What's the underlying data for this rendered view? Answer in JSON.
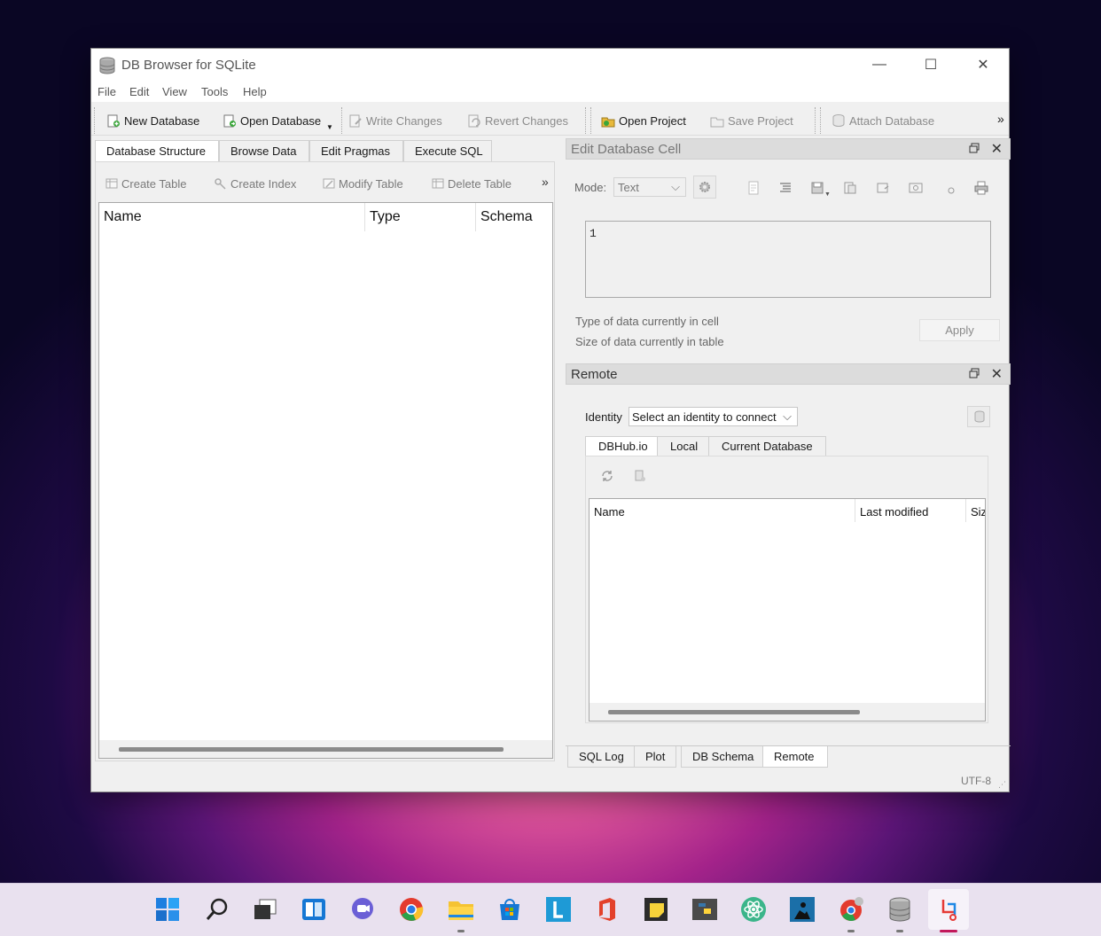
{
  "window": {
    "title": "DB Browser for SQLite",
    "controls": {
      "minimize": "—",
      "maximize": "☐",
      "close": "✕"
    }
  },
  "menu": [
    "File",
    "Edit",
    "View",
    "Tools",
    "Help"
  ],
  "toolbar": {
    "new_database": "New Database",
    "open_database": "Open Database",
    "write_changes": "Write Changes",
    "revert_changes": "Revert Changes",
    "open_project": "Open Project",
    "save_project": "Save Project",
    "attach_database": "Attach Database",
    "overflow": "»"
  },
  "main_tabs": [
    "Database Structure",
    "Browse Data",
    "Edit Pragmas",
    "Execute SQL"
  ],
  "structure_toolbar": {
    "create_table": "Create Table",
    "create_index": "Create Index",
    "modify_table": "Modify Table",
    "delete_table": "Delete Table",
    "overflow": "»"
  },
  "schema_tree": {
    "columns": [
      "Name",
      "Type",
      "Schema"
    ]
  },
  "edit_cell": {
    "title": "Edit Database Cell",
    "mode_label": "Mode:",
    "mode_value": "Text",
    "cell_value": "1",
    "type_info": "Type of data currently in cell",
    "size_info": "Size of data currently in table",
    "apply": "Apply"
  },
  "remote": {
    "title": "Remote",
    "identity_label": "Identity",
    "identity_value": "Select an identity to connect",
    "tabs": [
      "DBHub.io",
      "Local",
      "Current Database"
    ],
    "columns": [
      "Name",
      "Last modified",
      "Siz"
    ]
  },
  "bottom_tabs": [
    "SQL Log",
    "Plot",
    "DB Schema",
    "Remote"
  ],
  "status": {
    "encoding": "UTF-8"
  },
  "dock_controls": {
    "close": "✕"
  },
  "taskbar_icons": [
    "start-icon",
    "search-icon",
    "task-view-icon",
    "widgets-icon",
    "chat-icon",
    "chrome-icon",
    "file-explorer-icon",
    "store-icon",
    "app-l-icon",
    "office-icon",
    "sticky-notes-icon",
    "python-icon",
    "atom-icon",
    "kindle-icon",
    "chrome-dev-icon",
    "db-browser-icon",
    "snipping-tool-icon"
  ]
}
